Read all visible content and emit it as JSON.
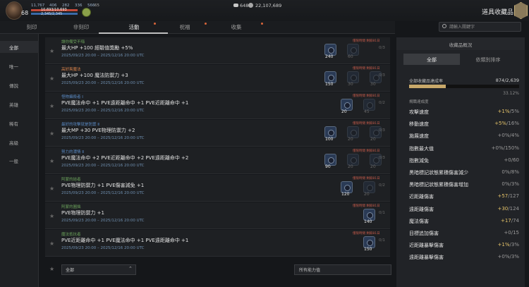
{
  "player": {
    "level": "68",
    "stat1": "11,767",
    "stat2": "406",
    "stat3": "282",
    "stat4": "336",
    "stat5": "566",
    "hp_text": "10,693/10,693",
    "mp_text": "2,345/2,345",
    "extra": "65"
  },
  "currency": {
    "silver": "648",
    "gold": "22,107,689"
  },
  "window_title": "道具收藏品",
  "tabs": [
    {
      "label": "刻印",
      "active": false
    },
    {
      "label": "非刻印",
      "active": false
    },
    {
      "label": "活動",
      "active": true
    },
    {
      "label": "祝福",
      "active": false
    },
    {
      "label": "收集",
      "active": false
    }
  ],
  "search": {
    "placeholder": "請輸入關鍵字"
  },
  "sidebar": {
    "items": [
      {
        "label": "全部",
        "active": true
      },
      {
        "label": "唯一"
      },
      {
        "label": "傳說"
      },
      {
        "label": "英雄"
      },
      {
        "label": "稀有"
      },
      {
        "label": "高級"
      },
      {
        "label": "一般"
      }
    ]
  },
  "rows": [
    {
      "title": "讓你備受不嗨",
      "tag": "僅限時間 剩餘81日",
      "effect": "最大HP +100 經驗值獎勵 +5%",
      "date": "2025/09/23 20:00 – 2025/12/16 20:00 UTC",
      "counts": [
        "240",
        "60"
      ],
      "frac": "0/3"
    },
    {
      "title": "高好爽魔法",
      "tag": "僅限時間 剩餘81日",
      "effect": "最大HP +100 魔法防禦力 +3",
      "date": "2025/09/23 20:00 – 2025/12/16 20:00 UTC",
      "counts": [
        "150",
        "30",
        "30"
      ],
      "frac": "0/3"
    },
    {
      "title": "怪物攝殺者 Ⅰ",
      "tag": "僅限時間 剩餘81日",
      "effect": "PVE魔法命中 +1 PVE遠距離命中 +1 PVE近距離命中 +1",
      "date": "2025/09/23 20:00 – 2025/12/16 20:00 UTC",
      "counts": [
        "20",
        "45"
      ],
      "frac": "0/2"
    },
    {
      "title": "最好的攻擊就是防禦 Ⅱ",
      "tag": "僅限時間 剩餘81日",
      "effect": "最大MP +30 PVE物理防禦力 +2",
      "date": "2025/09/23 20:00 – 2025/12/16 20:00 UTC",
      "counts": [
        "100",
        "20",
        "20"
      ],
      "frac": "0/3"
    },
    {
      "title": "努力的濃情 Ⅱ",
      "tag": "僅限時間 剩餘81日",
      "effect": "PVE魔法命中 +2 PVE近距離命中 +2 PVE遠距離命中 +2",
      "date": "2025/09/23 20:00 – 2025/12/16 20:00 UTC",
      "counts": [
        "90",
        "20",
        "20"
      ],
      "frac": "0/3"
    },
    {
      "title": "阿蒙的結者",
      "tag": "僅限時間 剩餘81日",
      "effect": "PVE物理防禦力 +1 PVE傷害減免 +1",
      "date": "2025/09/23 20:00 – 2025/12/16 20:00 UTC",
      "counts": [
        "120",
        "20"
      ],
      "frac": "0/2"
    },
    {
      "title": "阿蒙的圓拙",
      "tag": "僅限時間 剩餘81日",
      "effect": "PVE物理防禦力 +1",
      "date": "2025/09/23 20:00 – 2025/12/16 20:00 UTC",
      "counts": [
        "140"
      ],
      "frac": "0/1"
    },
    {
      "title": "魔法抵抗者",
      "tag": "僅限時間 剩餘81日",
      "effect": "PVE近距離命中 +1 PVE魔法命中 +1 PVE遠距離命中 +1",
      "date": "2025/09/23 20:00 – 2025/12/16 20:00 UTC",
      "counts": [
        "150"
      ],
      "frac": "0/1"
    }
  ],
  "bottom": {
    "dropdown": "全部",
    "filter": "所有能力值"
  },
  "panel": {
    "title": "收藏品概況",
    "tabs": [
      "全部",
      "依類別排序"
    ],
    "total_label": "全部收藏品達成率",
    "total_value": "874/2,639",
    "total_percent": "33.12%",
    "total_fraction": 0.3312,
    "sub_label": "規職達成度",
    "stats": [
      {
        "name": "攻擊速度",
        "cur": "+1%",
        "max": "/5%",
        "cls": "y"
      },
      {
        "name": "移動速度",
        "cur": "+5%",
        "max": "/16%",
        "cls": "y"
      },
      {
        "name": "施展速度",
        "cur": "+0%",
        "max": "/4%",
        "cls": ""
      },
      {
        "name": "指數最大值",
        "cur": "+0%",
        "max": "/150%",
        "cls": ""
      },
      {
        "name": "指數減免",
        "cur": "+0",
        "max": "/60",
        "cls": ""
      },
      {
        "name": "黑暗標記狀態累積傷害減少",
        "cur": "0%",
        "max": "/8%",
        "cls": ""
      },
      {
        "name": "黑暗標記狀態累積傷害增加",
        "cur": "0%",
        "max": "/3%",
        "cls": ""
      },
      {
        "name": "近距離傷害",
        "cur": "+57",
        "max": "/127",
        "cls": "y"
      },
      {
        "name": "遠距離傷害",
        "cur": "+30",
        "max": "/124",
        "cls": "y"
      },
      {
        "name": "魔法傷害",
        "cur": "+17",
        "max": "/74",
        "cls": "y"
      },
      {
        "name": "目標追加傷害",
        "cur": "+0",
        "max": "/15",
        "cls": ""
      },
      {
        "name": "近距離暴擊傷害",
        "cur": "+1%",
        "max": "/3%",
        "cls": "y"
      },
      {
        "name": "遠距離暴擊傷害",
        "cur": "+0%",
        "max": "/3%",
        "cls": ""
      }
    ]
  },
  "colors": {
    "accent": "#c8a86a",
    "tag": "#c45a4a",
    "date": "#6f8fb0"
  }
}
